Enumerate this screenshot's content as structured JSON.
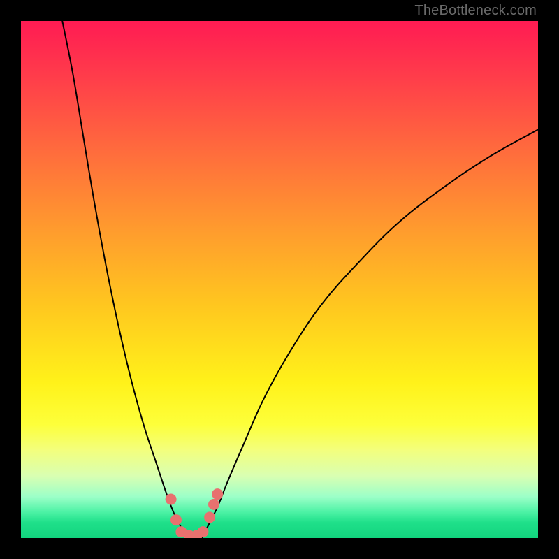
{
  "watermark": "TheBottleneck.com",
  "chart_data": {
    "type": "line",
    "title": "",
    "xlabel": "",
    "ylabel": "",
    "xlim": [
      0,
      100
    ],
    "ylim": [
      0,
      100
    ],
    "background_gradient": {
      "top_color": "#ff1b53",
      "mid_color": "#fff21a",
      "bottom_color": "#12d47e",
      "meaning": "red=high bottleneck, green=low bottleneck"
    },
    "series": [
      {
        "name": "left-branch",
        "x": [
          8,
          10,
          12,
          14,
          16,
          18,
          20,
          22,
          24,
          26,
          28,
          29.5,
          31,
          32
        ],
        "y": [
          100,
          90,
          78,
          66,
          55,
          45,
          36,
          28,
          21,
          15,
          9,
          5,
          2,
          0
        ]
      },
      {
        "name": "right-branch",
        "x": [
          35,
          36,
          38,
          40,
          43,
          47,
          52,
          58,
          65,
          73,
          82,
          91,
          100
        ],
        "y": [
          0,
          2,
          6,
          11,
          18,
          27,
          36,
          45,
          53,
          61,
          68,
          74,
          79
        ]
      }
    ],
    "markers": {
      "name": "highlighted-points",
      "color": "#e8716f",
      "points": [
        {
          "x": 29.0,
          "y": 7.5
        },
        {
          "x": 30.0,
          "y": 3.5
        },
        {
          "x": 31.0,
          "y": 1.2
        },
        {
          "x": 32.5,
          "y": 0.5
        },
        {
          "x": 34.0,
          "y": 0.5
        },
        {
          "x": 35.2,
          "y": 1.2
        },
        {
          "x": 36.5,
          "y": 4.0
        },
        {
          "x": 37.3,
          "y": 6.5
        },
        {
          "x": 38.0,
          "y": 8.5
        }
      ]
    }
  }
}
